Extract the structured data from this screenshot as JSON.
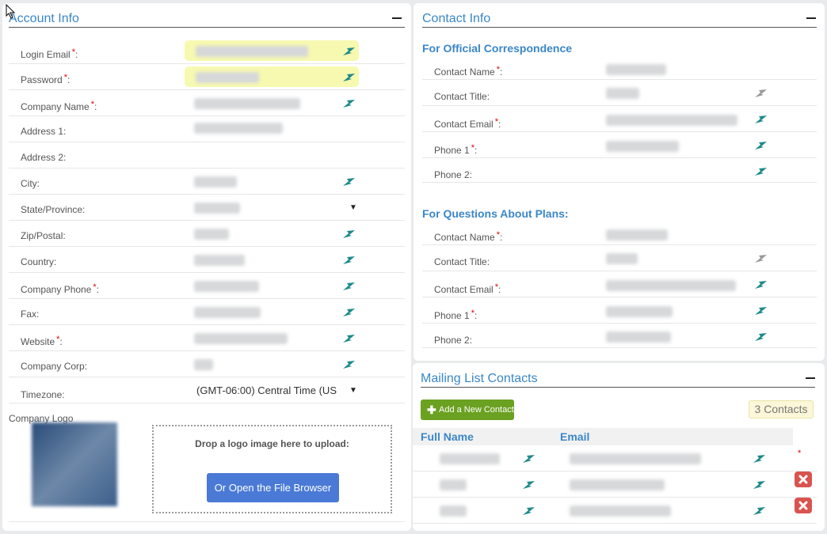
{
  "account": {
    "title": "Account Info",
    "fields": [
      {
        "label": "Login Email",
        "required": true
      },
      {
        "label": "Password",
        "required": true
      },
      {
        "label": "Company Name",
        "required": true
      },
      {
        "label": "Address 1:",
        "required": false
      },
      {
        "label": "Address 2:",
        "required": false
      },
      {
        "label": "City:",
        "required": false
      },
      {
        "label": "State/Province:",
        "required": false
      },
      {
        "label": "Zip/Postal:",
        "required": false
      },
      {
        "label": "Country:",
        "required": false
      },
      {
        "label": "Company Phone",
        "required": true
      },
      {
        "label": "Fax:",
        "required": false
      },
      {
        "label": "Website",
        "required": true
      },
      {
        "label": "Company Corp:",
        "required": false
      },
      {
        "label": "Timezone:",
        "required": false
      }
    ],
    "timezone_value": "(GMT-06:00) Central Time (US",
    "logo_label": "Company Logo",
    "drop_text": "Drop a logo image here to upload:",
    "file_browser_label": "Or Open the File Browser"
  },
  "contact": {
    "title": "Contact Info",
    "official_heading": "For Official Correspondence",
    "plans_heading": "For Questions About Plans:",
    "labels": [
      "Contact Name",
      "Contact Title:",
      "Contact Email",
      "Phone 1",
      "Phone 2:"
    ]
  },
  "mailing": {
    "title": "Mailing List Contacts",
    "add_label": "Add a New Contact",
    "count_label": "3 Contacts",
    "col_name": "Full Name",
    "col_email": "Email"
  },
  "colors": {
    "accent": "#3a87c8",
    "highlight": "#f7f9b0",
    "add_button": "#6aa121",
    "file_button": "#4a7ad6",
    "delete": "#d9534f"
  }
}
